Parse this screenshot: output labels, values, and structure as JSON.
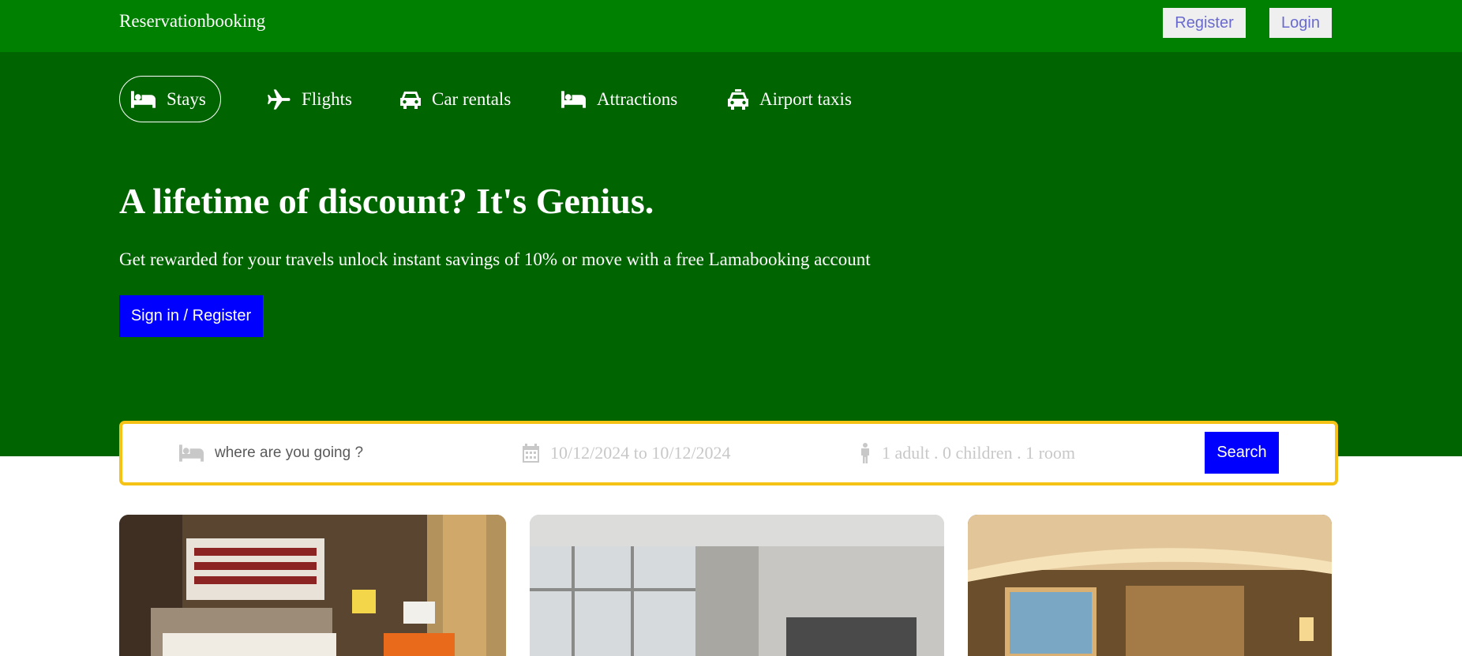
{
  "brand": "Reservationbooking",
  "navbar": {
    "register_label": "Register",
    "login_label": "Login"
  },
  "tabs": [
    {
      "label": "Stays",
      "icon": "bed-icon",
      "active": true
    },
    {
      "label": "Flights",
      "icon": "plane-icon",
      "active": false
    },
    {
      "label": "Car rentals",
      "icon": "car-icon",
      "active": false
    },
    {
      "label": "Attractions",
      "icon": "bed-icon",
      "active": false
    },
    {
      "label": "Airport taxis",
      "icon": "taxi-icon",
      "active": false
    }
  ],
  "hero": {
    "title": "A lifetime of discount? It's Genius.",
    "subtitle": "Get rewarded for your travels unlock instant savings of 10% or move with a free Lamabooking account",
    "signin_label": "Sign in / Register"
  },
  "search": {
    "destination_placeholder": "where are you going ?",
    "dates": "10/12/2024 to 10/12/2024",
    "guests": "1 adult . 0 children . 1 room",
    "button_label": "Search"
  },
  "cards": [
    {
      "image": "hotel-room-photo"
    },
    {
      "image": "hotel-room-photo"
    },
    {
      "image": "hotel-room-photo"
    }
  ],
  "colors": {
    "navbar": "#008000",
    "header": "#006400",
    "primary_button": "#0000ff",
    "searchbar_border": "#f5c216"
  }
}
